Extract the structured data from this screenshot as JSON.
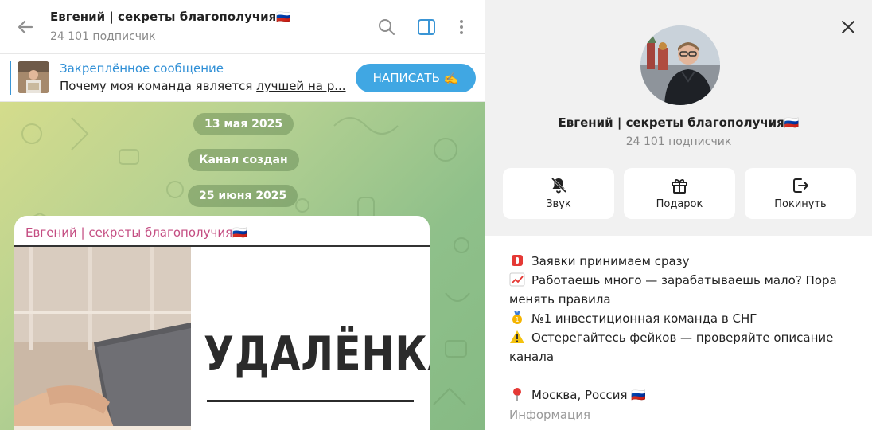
{
  "chat": {
    "title": "Евгений | секреты благополучия🇷🇺",
    "subtitle": "24 101 подписчик",
    "icons": [
      "back-arrow-icon",
      "search-icon",
      "sidebar-toggle-icon",
      "more-vertical-icon"
    ]
  },
  "pinned": {
    "title": "Закреплённое сообщение",
    "text_plain": "Почему моя команда является ",
    "text_underlined": "лучшей на р...",
    "button": "НАПИСАТЬ ✍️"
  },
  "messages": {
    "date1": "13 мая 2025",
    "service": "Канал создан",
    "date2": "25 июня 2025",
    "post_author": "Евгений | секреты благополучия🇷🇺",
    "post_image_text": "УДАЛЁНКА"
  },
  "profile": {
    "name": "Евгений | секреты благополучия🇷🇺",
    "subscribers": "24 101 подписчик",
    "actions": [
      {
        "label": "Звук",
        "icon": "bell-off-icon"
      },
      {
        "label": "Подарок",
        "icon": "gift-icon"
      },
      {
        "label": "Покинуть",
        "icon": "leave-icon"
      }
    ],
    "description": {
      "line1": "Заявки принимаем сразу",
      "line2a": "Работаешь много — зарабатываешь мало? Пора",
      "line2b": "менять правила",
      "line3": "№1 инвестиционная команда в СНГ",
      "line4a": "Остерегайтесь фейков — проверяйте описание",
      "line4b": "канала",
      "line5": "Москва, Россия 🇷🇺"
    },
    "info_label": "Информация"
  },
  "colors": {
    "accent": "#40a7e3",
    "pinned_title": "#2f8fd6",
    "author": "#c44d82"
  }
}
